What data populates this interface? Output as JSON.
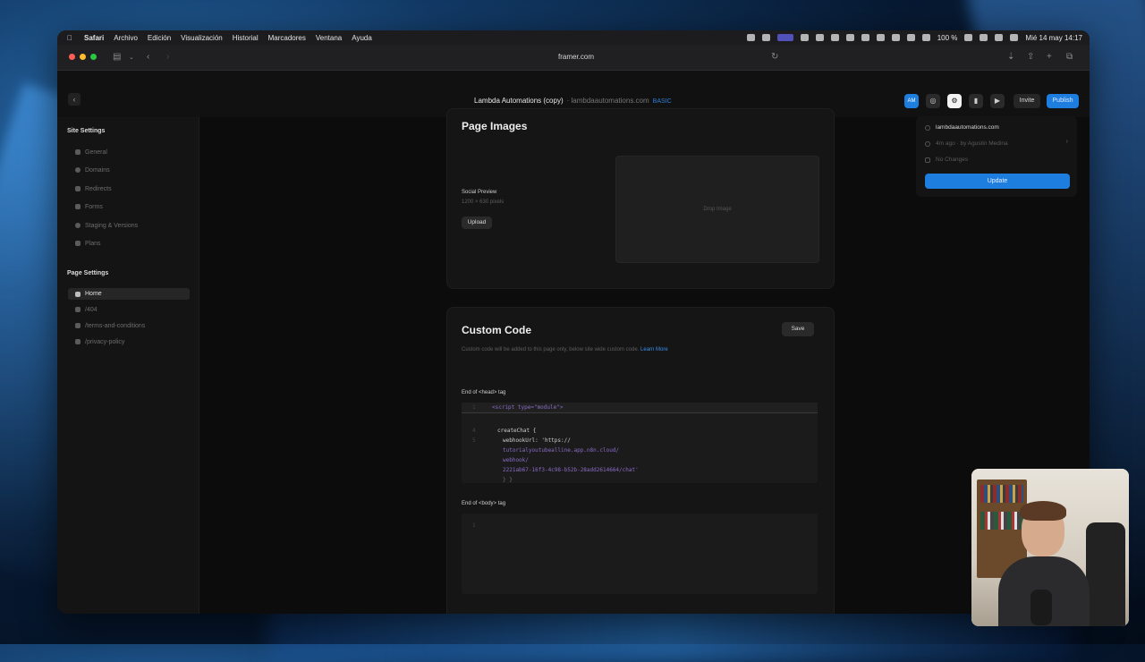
{
  "menubar": {
    "app": "Safari",
    "items": [
      "Archivo",
      "Edición",
      "Visualización",
      "Historial",
      "Marcadores",
      "Ventana",
      "Ayuda"
    ],
    "battery": "100 %",
    "clock": "Mié 14 may 14:17"
  },
  "browser": {
    "url": "framer.com"
  },
  "framer": {
    "project_title": "Lambda Automations (copy)",
    "project_domain": "lambdaautomations.com",
    "plan_badge": "BASIC",
    "avatar_initials": "AM",
    "invite_label": "Invite",
    "publish_label": "Publish"
  },
  "sidebar": {
    "site_settings_title": "Site Settings",
    "site_items": [
      {
        "label": "General"
      },
      {
        "label": "Domains"
      },
      {
        "label": "Redirects"
      },
      {
        "label": "Forms"
      },
      {
        "label": "Staging & Versions"
      },
      {
        "label": "Plans"
      }
    ],
    "page_settings_title": "Page Settings",
    "page_items": [
      {
        "label": "Home"
      },
      {
        "label": "/404"
      },
      {
        "label": "/terms-and-conditions"
      },
      {
        "label": "/privacy-policy"
      }
    ]
  },
  "page_images": {
    "title": "Page Images",
    "social_label": "Social Preview",
    "social_hint": "1200 × 630 pixels",
    "upload_label": "Upload",
    "drop_label": "Drop Image"
  },
  "custom_code": {
    "title": "Custom Code",
    "save_label": "Save",
    "description": "Custom code will be added to this page only, below site wide custom code.",
    "learn_more": "Learn More",
    "head_label": "End of <head> tag",
    "head_code": [
      {
        "n": "1",
        "text": "<script type=\"module\">"
      },
      {
        "n": "4",
        "text": "  createChat {"
      },
      {
        "n": "5",
        "text": "     webhookUrl: 'https://"
      },
      {
        "n": "",
        "text": "     tutorialyoutubealline.app.n8n.cloud/"
      },
      {
        "n": "",
        "text": "     webhook/"
      },
      {
        "n": "",
        "text": "     2221ab67-16f3-4c98-b52b-28add2614664/chat'"
      },
      {
        "n": "",
        "text": "  } }"
      }
    ],
    "body_label": "End of <body> tag",
    "body_line": "1"
  },
  "publish_popover": {
    "domain": "lambdaautomations.com",
    "last_published": "4m ago · by Agustin Medina",
    "changes": "No Changes",
    "update_label": "Update"
  }
}
